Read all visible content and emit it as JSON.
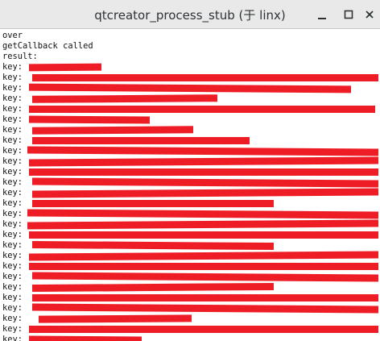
{
  "window": {
    "title": "qtcreator_process_stub (于 linx)",
    "buttons": {
      "minimize": "minimize",
      "maximize": "maximize",
      "close": "close"
    }
  },
  "terminal": {
    "header_lines": [
      "over",
      "getCallback called",
      "result:"
    ],
    "key_prefix": "key:",
    "key_line_count": 27,
    "redaction_color": "#ee1d25"
  }
}
